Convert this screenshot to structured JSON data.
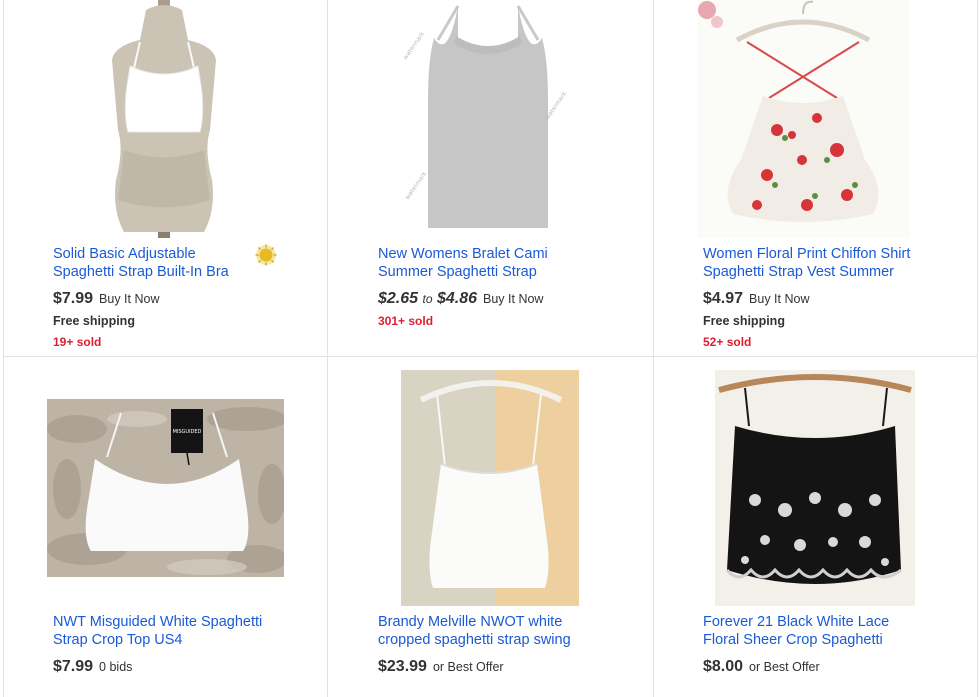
{
  "listings": [
    {
      "title_line1": "Solid Basic Adjustable",
      "title_line2": "Spaghetti Strap Built-In Bra",
      "price": "$7.99",
      "format": "Buy It Now",
      "shipping": "Free shipping",
      "sold": "19+ sold",
      "badge_icon": "top-rated-seller-icon",
      "image_icon": "white-cami-on-mannequin"
    },
    {
      "title_line1": "New Womens Bralet Cami",
      "title_line2": "Summer Spaghetti Strap",
      "price_low": "$2.65",
      "price_to": "to",
      "price_high": "$4.86",
      "format": "Buy It Now",
      "sold": "301+ sold",
      "image_icon": "grey-halter-crop-top"
    },
    {
      "title_line1": "Women Floral Print Chiffon Shirt",
      "title_line2": "Spaghetti Strap Vest Summer",
      "price": "$4.97",
      "format": "Buy It Now",
      "shipping": "Free shipping",
      "sold": "52+ sold",
      "image_icon": "floral-chiffon-cami"
    },
    {
      "title_line1": "NWT Misguided White Spaghetti",
      "title_line2": "Strap Crop Top US4",
      "price": "$7.99",
      "format": "0 bids",
      "image_icon": "white-crop-top-on-fur",
      "tag_text": "MISGUIDED"
    },
    {
      "title_line1": "Brandy Melville NWOT white",
      "title_line2": "cropped spaghetti strap swing",
      "price": "$23.99",
      "format": "or Best Offer",
      "image_icon": "white-swing-cami-on-hanger"
    },
    {
      "title_line1": "Forever 21 Black White Lace",
      "title_line2": "Floral Sheer Crop Spaghetti",
      "price": "$8.00",
      "format": "or Best Offer",
      "image_icon": "black-lace-crop-on-hanger"
    }
  ],
  "colors": {
    "link": "#1a5ad5",
    "sold": "#dd1e31",
    "divider": "#e2e2e2"
  }
}
